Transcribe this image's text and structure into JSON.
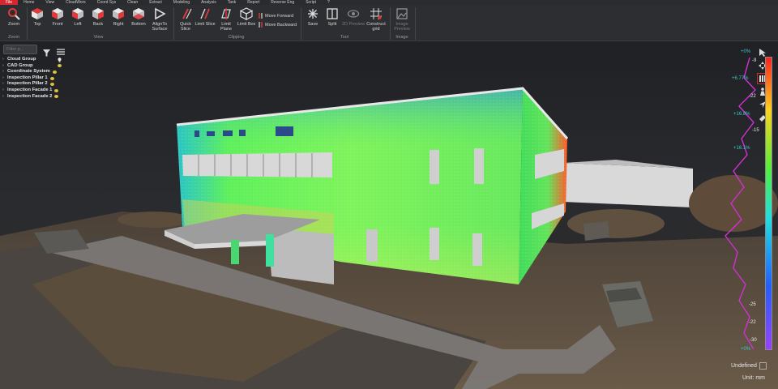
{
  "menu": {
    "items": [
      "File",
      "Home",
      "View",
      "CloudWorx",
      "Coord Sys",
      "Clean",
      "Extract",
      "Modeling",
      "Analysis",
      "Tank",
      "Report",
      "Reverse Eng",
      "Script",
      "?"
    ]
  },
  "ribbon": {
    "zoom": {
      "label": "Zoom",
      "group": "Zoom"
    },
    "view": {
      "buttons": [
        "Top",
        "Front",
        "Left",
        "Back",
        "Right",
        "Bottom"
      ],
      "align_line1": "AlignTo",
      "align_line2": "Surface",
      "group": "View"
    },
    "clipping": {
      "quick_line1": "Quick",
      "quick_line2": "Slice",
      "limit_slice": "Limit Slice",
      "limit_plane_line1": "Limit",
      "limit_plane_line2": "Plane",
      "limit_box": "Limit Box",
      "move_forward": "Move Forward",
      "move_backward": "Move Backward",
      "group": "Clipping"
    },
    "tool": {
      "save": "Save",
      "split": "Split",
      "preview": "2D Preview",
      "construct_line1": "Construct",
      "construct_line2": "grid",
      "group": "Tool"
    },
    "image": {
      "label_line1": "Image",
      "label_line2": "Preview",
      "group": "Image"
    }
  },
  "tree": {
    "filter_placeholder": "Filter p...",
    "items": [
      "Cloud Group",
      "CAD Group",
      "Coordinate System",
      "Inspection Pillar 1",
      "Inspection Pillar 2",
      "Inspection Facade 1",
      "Inspection Facade 2"
    ]
  },
  "scale": {
    "right_labels": [
      "+0%",
      "+6.77%",
      "+16.8%",
      "+16.1%",
      "+0%"
    ],
    "left_labels": [
      "-9",
      "-22",
      "-15"
    ],
    "mid_left": "-25",
    "left_bottom": [
      "-22",
      "-30"
    ],
    "undefined_label": "Undefined",
    "unit_label": "Unit: mm"
  },
  "colors": {
    "accent": "#d9262e",
    "menubar": "#2a2b2e",
    "ribbon": "#2d2e31",
    "panel_text": "#e6e6e6",
    "scale_text": "#3cc7d0"
  }
}
